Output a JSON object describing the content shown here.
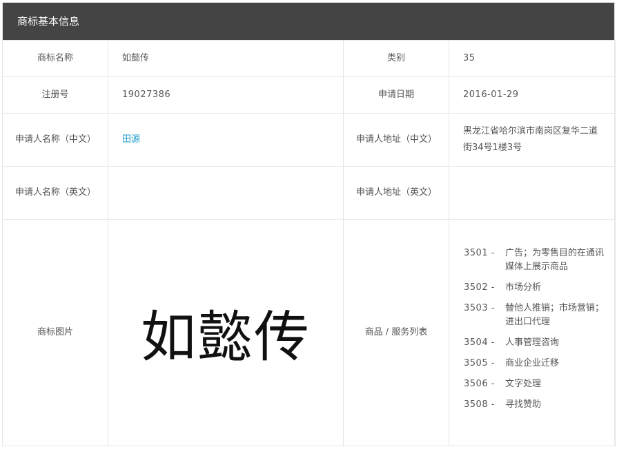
{
  "header": {
    "title": "商标基本信息"
  },
  "fields": {
    "tm_name_label": "商标名称",
    "tm_name": "如懿传",
    "class_label": "类别",
    "class_value": "35",
    "reg_no_label": "注册号",
    "reg_no": "19027386",
    "apply_date_label": "申请日期",
    "apply_date": "2016-01-29",
    "applicant_cn_label": "申请人名称（中文）",
    "applicant_cn": "田源",
    "address_cn_label": "申请人地址（中文）",
    "address_cn": "黑龙江省哈尔滨市南岗区复华二道街34号1楼3号",
    "applicant_en_label": "申请人名称（英文）",
    "applicant_en": "",
    "address_en_label": "申请人地址（英文）",
    "address_en": "",
    "image_label": "商标图片",
    "image_text": "如懿传",
    "services_label": "商品 / 服务列表"
  },
  "services": [
    {
      "code": "3501 -",
      "name": "广告；为零售目的在通讯媒体上展示商品"
    },
    {
      "code": "3502 -",
      "name": "市场分析"
    },
    {
      "code": "3503 -",
      "name": "替他人推销；市场营销；进出口代理"
    },
    {
      "code": "3504 -",
      "name": "人事管理咨询"
    },
    {
      "code": "3505 -",
      "name": "商业企业迁移"
    },
    {
      "code": "3506 -",
      "name": "文字处理"
    },
    {
      "code": "3508 -",
      "name": "寻找赞助"
    }
  ],
  "colors": {
    "header_bg": "#444444",
    "link": "#1a9bc9",
    "border": "#e6e6e6"
  }
}
